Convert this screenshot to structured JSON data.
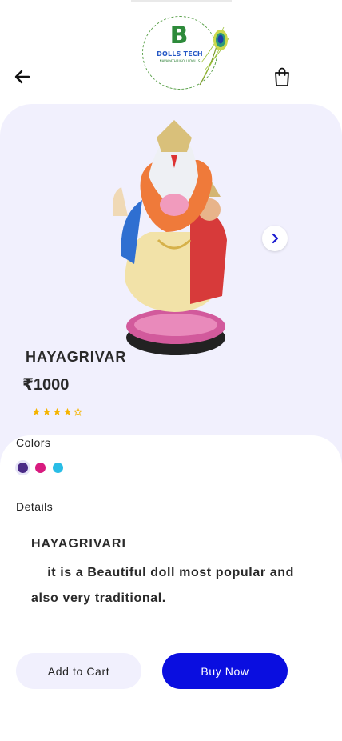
{
  "brand": {
    "name": "DOLLS TECH",
    "tagline": "NAVARATHRIGOLU DOLLS",
    "initial": "B"
  },
  "icons": {
    "back": "arrow-left-icon",
    "bag": "shopping-bag-icon",
    "next": "chevron-right-icon",
    "star": "star-icon"
  },
  "product": {
    "name": "HAYAGRIVAR",
    "price": "₹1000",
    "rating": 4,
    "rating_max": 5
  },
  "colors": {
    "label": "Colors",
    "options": [
      "#4a2a86",
      "#d81b7f",
      "#29bde6"
    ],
    "selected_index": 0
  },
  "details": {
    "label": "Details",
    "title": "HAYAGRIVARI",
    "body": "it is a Beautiful doll most popular and also very traditional."
  },
  "actions": {
    "add_to_cart": "Add to Cart",
    "buy_now": "Buy Now"
  },
  "theme": {
    "accent": "#0a0ee0",
    "hero_bg": "#f1f0fd",
    "star": "#f5b400"
  }
}
